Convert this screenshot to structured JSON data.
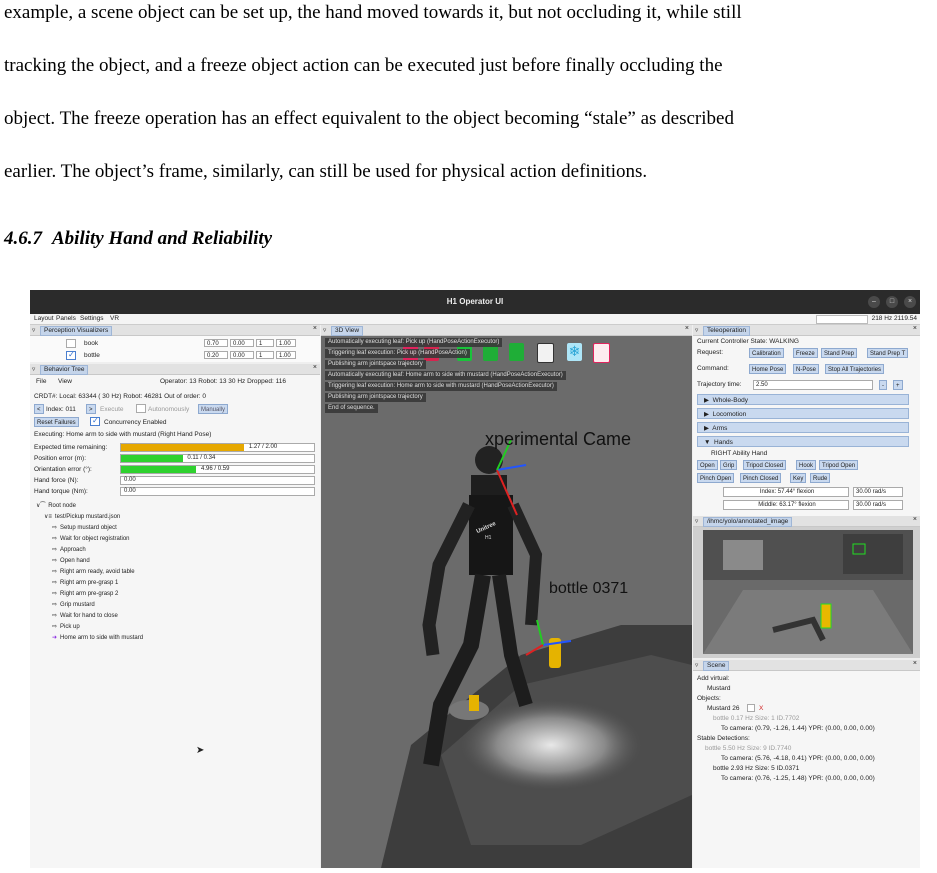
{
  "paragraph": {
    "lines": [
      "example, a scene object can be set up, the hand moved towards it, but not occluding it, while still",
      "tracking the object, and a freeze object action can be executed just before finally occluding the",
      "object. The freeze operation has an effect equivalent to the object becoming “stale” as described",
      "earlier. The object’s frame, similarly, can still be used for physical action definitions."
    ]
  },
  "section": {
    "number": "4.6.7",
    "title": "Ability Hand and Reliability"
  },
  "app": {
    "window_title": "H1 Operator UI",
    "menu": [
      "Layout",
      "Panels",
      "Settings",
      "VR"
    ],
    "rate_text": "218 Hz  2119.54",
    "perception": {
      "title": "Perception Visualizers",
      "rows": [
        {
          "name": "book",
          "v1": "0.70",
          "v2": "0.00",
          "v3": "1",
          "v4": "1.00",
          "checked": false
        },
        {
          "name": "bottle",
          "v1": "0.20",
          "v2": "0.00",
          "v3": "1",
          "v4": "1.00",
          "checked": true
        }
      ]
    },
    "behavior": {
      "title": "Behavior Tree",
      "file": "File",
      "view": "View",
      "status": "Operator: 13  Robot: 13   30 Hz  Dropped: 116",
      "crdt": "CRDT#: Local: 63344 ( 30 Hz)  Robot: 46281  Out of order: 0",
      "index": "Index: 011",
      "execute": "Execute",
      "autonomously": "Autonomously",
      "manually": "Manually",
      "reset": "Reset Failures",
      "concurrency": "Concurrency Enabled",
      "executing": "Executing:  Home arm to side with mustard (Right Hand Pose)",
      "metrics": [
        {
          "label": "Expected time remaining:",
          "value": "1.27 / 2.00",
          "fraction": 0.635,
          "color": "#e6a800"
        },
        {
          "label": "Position error (m):",
          "value": "0.11 / 0.34",
          "fraction": 0.32,
          "color": "#2fd12f"
        },
        {
          "label": "Orientation error (°):",
          "value": "4.96 / 0.59",
          "fraction": 0.39,
          "color": "#2fd12f"
        },
        {
          "label": "Hand force (N):",
          "value": "0.00",
          "fraction": 0,
          "color": "#2fd12f"
        },
        {
          "label": "Hand torque (Nm):",
          "value": "0.00",
          "fraction": 0,
          "color": "#2fd12f"
        }
      ],
      "tree": [
        {
          "text": "Root node",
          "depth": 0,
          "glyph": "∨⁀"
        },
        {
          "text": "test/Pickup mustard.json",
          "depth": 1,
          "glyph": "∨≡"
        },
        {
          "text": "Setup mustard object",
          "depth": 2,
          "glyph": "⇨"
        },
        {
          "text": "Wait for object registration",
          "depth": 2,
          "glyph": "⇨"
        },
        {
          "text": "Approach",
          "depth": 2,
          "glyph": "⇨"
        },
        {
          "text": "Open hand",
          "depth": 2,
          "glyph": "⇨"
        },
        {
          "text": "Right arm ready, avoid table",
          "depth": 2,
          "glyph": "⇨"
        },
        {
          "text": "Right arm pre-grasp 1",
          "depth": 2,
          "glyph": "⇨"
        },
        {
          "text": "Right arm pre-grasp 2",
          "depth": 2,
          "glyph": "⇨"
        },
        {
          "text": "Grip mustard",
          "depth": 2,
          "glyph": "⇨"
        },
        {
          "text": "Wait for hand to close",
          "depth": 2,
          "glyph": "⇨"
        },
        {
          "text": "Pick up",
          "depth": 2,
          "glyph": "⇨"
        },
        {
          "text": "Home arm to side with mustard",
          "depth": 2,
          "glyph": "➜"
        }
      ]
    },
    "view3d": {
      "title": "3D View",
      "log": [
        "Automatically executing leaf: Pick up (HandPoseActionExecutor)",
        "Triggering leaf execution: Pick up (HandPoseAction)",
        "Publishing arm jointspace trajectory",
        "Automatically executing leaf: Home arm to side with mustard (HandPoseActionExecutor)",
        "Triggering leaf execution: Home arm to side with mustard (HandPoseActionExecutor)",
        "Publishing arm jointspace trajectory",
        "End of sequence."
      ],
      "camera_label": "xperimental Came",
      "bottle_label": "bottle 0371",
      "robot_brand": "Unitree",
      "robot_model": "H1"
    },
    "teleop": {
      "title": "Teleoperation",
      "state": "Current Controller State: WALKING",
      "request_label": "Request:",
      "request_buttons": [
        "Calibration",
        "Freeze",
        "Stand Prep",
        "Stand Prep T"
      ],
      "command_label": "Command:",
      "command_buttons": [
        "Home Pose",
        "N-Pose",
        "Stop All Trajectories"
      ],
      "traj_label": "Trajectory time:",
      "traj_value": "2.50",
      "sections": [
        "Whole-Body",
        "Locomotion",
        "Arms",
        "Hands"
      ],
      "hand_title": "RIGHT Ability Hand",
      "hand_row1": [
        "Open",
        "Grip",
        "Tripod Closed",
        "Hook",
        "Tripod Open"
      ],
      "hand_row2": [
        "Pinch Open",
        "Pinch Closed",
        "Key",
        "Rude"
      ],
      "fingers": [
        {
          "label": "Index: 57.44° flexion",
          "speed": "30.00 rad/s"
        },
        {
          "label": "Middle: 63.17° flexion",
          "speed": "30.00 rad/s"
        }
      ]
    },
    "yolo": {
      "title": "/ihmc/yolo/annotated_image"
    },
    "scene": {
      "title": "Scene",
      "add_virtual": "Add virtual:",
      "virtual_item": "Mustard",
      "objects": "Objects:",
      "mustard": "Mustard 26",
      "mustard_x": "X",
      "lines": [
        {
          "text": "bottle 0.17 Hz Size: 1 ID.7702",
          "gray": true,
          "indent": 2
        },
        {
          "text": "To camera: (0.79, -1.26, 1.44) YPR: (0.00, 0.00, 0.00)",
          "gray": false,
          "indent": 3
        },
        {
          "text": "Stable Detections:",
          "gray": false,
          "indent": 0
        },
        {
          "text": "bottle 5.50 Hz Size: 9 ID.7740",
          "gray": true,
          "indent": 1
        },
        {
          "text": "To camera: (5.76, -4.18, 0.41) YPR: (0.00, 0.00, 0.00)",
          "gray": false,
          "indent": 3
        },
        {
          "text": "bottle 2.93 Hz Size: 5 ID.0371",
          "gray": false,
          "indent": 2
        },
        {
          "text": "To camera: (0.76, -1.25, 1.48) YPR: (0.00, 0.00, 0.00)",
          "gray": false,
          "indent": 3
        }
      ]
    },
    "colors": {
      "accent": "#c9d9ef",
      "dark": "#2b2b2b",
      "progress_orange": "#e6a800",
      "progress_green": "#2fd12f"
    }
  }
}
